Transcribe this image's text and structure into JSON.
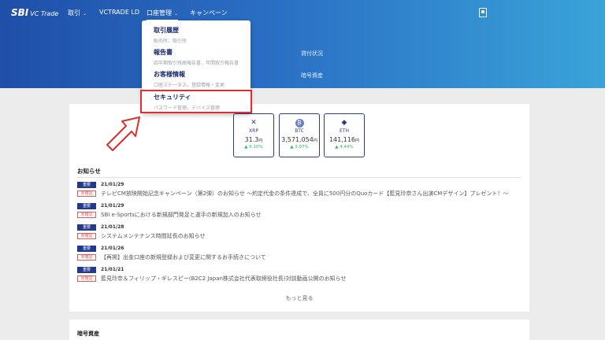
{
  "brand": {
    "logo": "SBI",
    "logo_sub": "VC Trade"
  },
  "nav": {
    "items": [
      {
        "label": "取引",
        "chevron": true
      },
      {
        "label": "VCTRADE LD",
        "chevron": false
      },
      {
        "label": "口座管理",
        "chevron": true
      },
      {
        "label": "キャンペーン",
        "chevron": false
      }
    ],
    "user_icon": "user-card-icon"
  },
  "hero": {
    "links": [
      "貸付状況",
      "暗号資産"
    ]
  },
  "dropdown": {
    "items": [
      {
        "title": "取引履歴",
        "desc": "販売所、取引所"
      },
      {
        "title": "報告書",
        "desc": "四半期取引残高報告書、年間取引報告書"
      },
      {
        "title": "お客様情報",
        "desc": "口座ステータス、登録情報・変更"
      },
      {
        "title": "セキュリティ",
        "desc": "パスワード管理、デバイス管理"
      }
    ],
    "highlight_color": "#e02d2d"
  },
  "coins": [
    {
      "symbol": "XRP",
      "icon": "xrp-icon",
      "glyph": "✕",
      "price": "31.3",
      "unit": "円",
      "change": "▲ 6.10%"
    },
    {
      "symbol": "BTC",
      "icon": "btc-icon",
      "glyph": "₿",
      "price": "3,571,054",
      "unit": "円",
      "change": "▲ 3.07%"
    },
    {
      "symbol": "ETH",
      "icon": "eth-icon",
      "glyph": "◆",
      "price": "141,116",
      "unit": "円",
      "change": "▲ 4.44%"
    }
  ],
  "news": {
    "heading": "お知らせ",
    "items": [
      {
        "category": "重要",
        "status": "未確認",
        "date": "21/01/29",
        "text": "テレビCM放映開始記念キャンペーン（第2弾）のお知らせ ～約定代金の条件達成で、全員に500円分のQuoカード【藍見玲奈さん出演CMデザイン】プレゼント！～"
      },
      {
        "category": "重要",
        "status": "未確認",
        "date": "21/01/29",
        "text": "SBI e-Sportsにおける新規部門発足と選手の新規加入のお知らせ"
      },
      {
        "category": "重要",
        "status": "未確認",
        "date": "21/01/28",
        "text": "システムメンテナンス時間延長のお知らせ"
      },
      {
        "category": "重要",
        "status": "未確認",
        "date": "21/01/26",
        "text": "【再掲】出金口座の新規登録および変更に関するお手続きについて"
      },
      {
        "category": "重要",
        "status": "未確認",
        "date": "21/01/21",
        "text": "藍見玲奈＆フィリップ・ギレスピー(B2C2 Japan株式会社代表取締役社長)対談動画公開のお知らせ"
      }
    ],
    "more_label": "もっと見る"
  },
  "assets": {
    "heading": "暗号資産"
  },
  "colors": {
    "accent": "#223a8c",
    "up": "#2bb673",
    "alert": "#e02d2d"
  }
}
